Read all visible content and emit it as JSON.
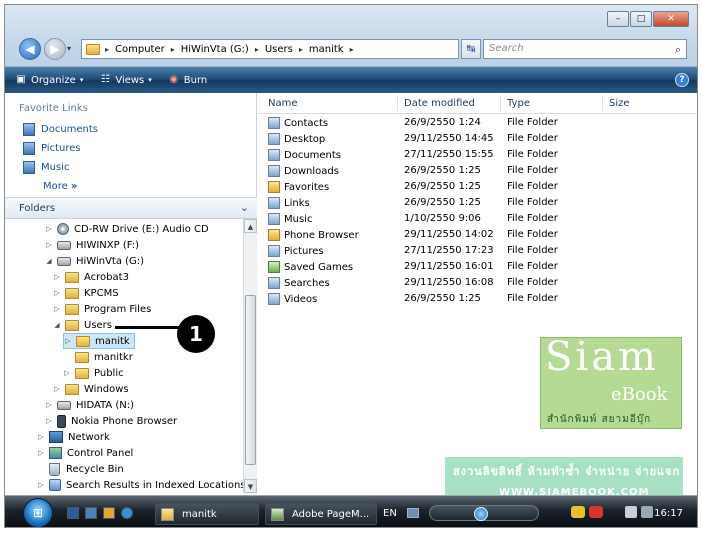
{
  "window": {
    "min_label": "–",
    "max_label": "□",
    "close_label": "✕"
  },
  "address": {
    "segments": [
      "Computer",
      "HiWinVta (G:)",
      "Users",
      "manitk"
    ],
    "separator": "▸",
    "refresh": "↹",
    "search_placeholder": "Search",
    "search_icon": "⌕"
  },
  "nav": {
    "back": "◀",
    "forward": "▶",
    "dropdown": "▾"
  },
  "toolbar": {
    "organize": "Organize",
    "views": "Views",
    "burn": "Burn",
    "dropdown": "▾",
    "help": "?"
  },
  "favorites": {
    "title": "Favorite Links",
    "items": [
      "Documents",
      "Pictures",
      "Music"
    ],
    "more": "More",
    "more_chev": "»"
  },
  "folders": {
    "title": "Folders",
    "chev": "⌄",
    "tree": [
      {
        "label": "CD-RW Drive (E:) Audio CD",
        "exp": "▷"
      },
      {
        "label": "HIWINXP (F:)",
        "exp": "▷"
      },
      {
        "label": "HiWinVta (G:)",
        "exp": "◢"
      },
      {
        "label": "Acrobat3",
        "exp": "▷"
      },
      {
        "label": "KPCMS",
        "exp": "▷"
      },
      {
        "label": "Program Files",
        "exp": "▷"
      },
      {
        "label": "Users",
        "exp": "◢"
      },
      {
        "label": "manitk",
        "exp": "▷"
      },
      {
        "label": "manitkr",
        "exp": ""
      },
      {
        "label": "Public",
        "exp": "▷"
      },
      {
        "label": "Windows",
        "exp": "▷"
      },
      {
        "label": "HIDATA (N:)",
        "exp": "▷"
      },
      {
        "label": "Nokia Phone Browser",
        "exp": "▷"
      },
      {
        "label": "Network",
        "exp": "▷"
      },
      {
        "label": "Control Panel",
        "exp": "▷"
      },
      {
        "label": "Recycle Bin",
        "exp": ""
      },
      {
        "label": "Search Results in Indexed Locations",
        "exp": "▷"
      }
    ],
    "scroll_up": "▲",
    "scroll_down": "▼"
  },
  "annotation": {
    "number": "1"
  },
  "columns": [
    "Name",
    "Date modified",
    "Type",
    "Size"
  ],
  "files": [
    {
      "name": "Contacts",
      "date": "26/9/2550 1:24",
      "type": "File Folder"
    },
    {
      "name": "Desktop",
      "date": "29/11/2550 14:45",
      "type": "File Folder"
    },
    {
      "name": "Documents",
      "date": "27/11/2550 15:55",
      "type": "File Folder"
    },
    {
      "name": "Downloads",
      "date": "26/9/2550 1:25",
      "type": "File Folder"
    },
    {
      "name": "Favorites",
      "date": "26/9/2550 1:25",
      "type": "File Folder"
    },
    {
      "name": "Links",
      "date": "26/9/2550 1:25",
      "type": "File Folder"
    },
    {
      "name": "Music",
      "date": "1/10/2550 9:06",
      "type": "File Folder"
    },
    {
      "name": "Phone Browser",
      "date": "29/11/2550 14:02",
      "type": "File Folder"
    },
    {
      "name": "Pictures",
      "date": "27/11/2550 17:23",
      "type": "File Folder"
    },
    {
      "name": "Saved Games",
      "date": "29/11/2550 16:01",
      "type": "File Folder"
    },
    {
      "name": "Searches",
      "date": "29/11/2550 16:08",
      "type": "File Folder"
    },
    {
      "name": "Videos",
      "date": "26/9/2550 1:25",
      "type": "File Folder"
    }
  ],
  "watermark": {
    "brand": "Siam",
    "sub": "eBook",
    "thai": "สำนักพิมพ์ สยามอีบุ๊ก"
  },
  "banner": {
    "line1": "สงวนลิขสิทธิ์ ห้ามทำซ้ำ จำหน่าย จ่ายแจก",
    "line2": "WWW.SIAMEBOOK.COM"
  },
  "taskbar": {
    "start_glyph": "⊞",
    "task1": "manitk",
    "task2": "Adobe PageM...",
    "lang": "EN",
    "clock": "16:17"
  }
}
